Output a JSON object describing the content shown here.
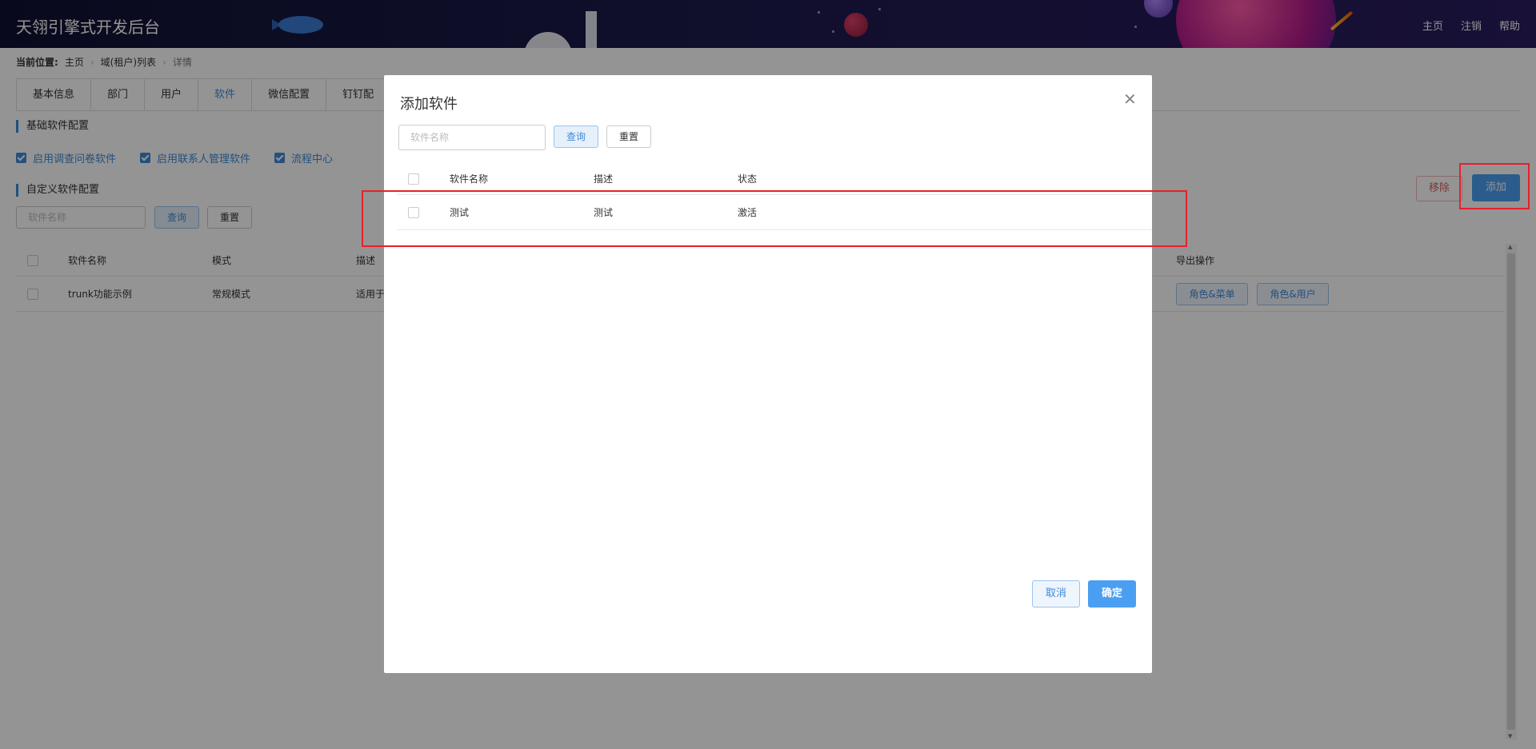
{
  "header": {
    "title": "天翎引擎式开发后台",
    "nav": [
      "主页",
      "注销",
      "帮助"
    ]
  },
  "breadcrumb": {
    "label": "当前位置:",
    "items": [
      "主页",
      "域(租户)列表"
    ],
    "current": "详情"
  },
  "tabs": [
    {
      "label": "基本信息",
      "active": false
    },
    {
      "label": "部门",
      "active": false
    },
    {
      "label": "用户",
      "active": false
    },
    {
      "label": "软件",
      "active": true
    },
    {
      "label": "微信配置",
      "active": false
    },
    {
      "label": "钉钉配",
      "active": false
    }
  ],
  "basic_section": {
    "title": "基础软件配置",
    "checkboxes": [
      {
        "label": "启用调查问卷软件",
        "checked": true
      },
      {
        "label": "启用联系人管理软件",
        "checked": true
      },
      {
        "label": "流程中心",
        "checked": true
      }
    ]
  },
  "custom_section": {
    "title": "自定义软件配置",
    "search_placeholder": "软件名称",
    "query_label": "查询",
    "reset_label": "重置",
    "remove_label": "移除",
    "add_label": "添加",
    "columns": [
      "软件名称",
      "模式",
      "描述",
      "导出操作"
    ],
    "rows": [
      {
        "name": "trunk功能示例",
        "mode": "常规模式",
        "desc": "适用于",
        "actions": [
          "角色&菜单",
          "角色&用户"
        ]
      }
    ]
  },
  "modal": {
    "title": "添加软件",
    "close_icon": "close-icon",
    "search_placeholder": "软件名称",
    "query_label": "查询",
    "reset_label": "重置",
    "columns": [
      "软件名称",
      "描述",
      "状态"
    ],
    "rows": [
      {
        "name": "测试",
        "desc": "测试",
        "status": "激活"
      }
    ],
    "cancel_label": "取消",
    "ok_label": "确定"
  },
  "colors": {
    "accent": "#3e8bd8",
    "primary_button": "#4a9ff2",
    "highlight": "#e8202a",
    "danger_text": "#e05b5b"
  }
}
